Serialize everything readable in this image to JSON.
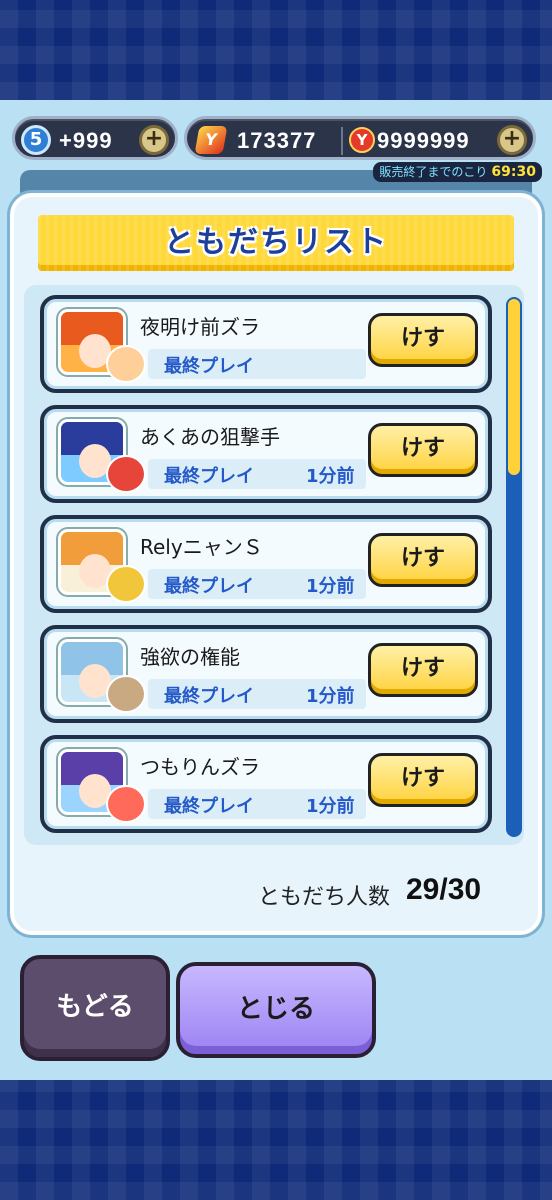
{
  "currency": {
    "gems": "5",
    "stamina": "+999",
    "coins": "173377",
    "ymoney": "9999999",
    "plus_symbol": "+"
  },
  "sale_timer": {
    "label": "販売終了までのこり",
    "time": "69:30"
  },
  "dialog": {
    "title": "ともだちリスト",
    "last_play_label": "最終プレイ",
    "remove_label": "けす",
    "friends": [
      {
        "name": "夜明け前ズラ",
        "last_play": ""
      },
      {
        "name": "あくあの狙撃手",
        "last_play": "1分前"
      },
      {
        "name": "RelyニャンＳ",
        "last_play": "1分前"
      },
      {
        "name": "強欲の権能",
        "last_play": "1分前"
      },
      {
        "name": "つもりんズラ",
        "last_play": "1分前"
      }
    ],
    "friend_count_label": "ともだち人数",
    "friend_count_value": "29/30",
    "scroll_position": 0.0
  },
  "buttons": {
    "back": "もどる",
    "close": "とじる"
  },
  "colors": {
    "title_text": "#1b3f9a",
    "banner": "#ffd83a",
    "remove_button": "#ffd23c",
    "close_button": "#9c82f2",
    "back_button": "#5c4d6d",
    "last_play_text": "#2459c9"
  }
}
